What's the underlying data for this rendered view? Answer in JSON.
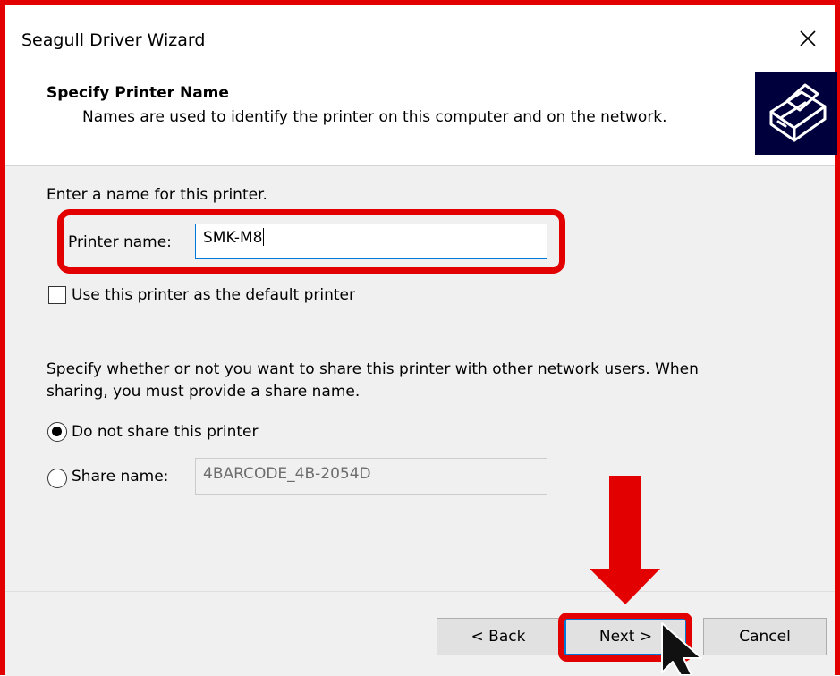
{
  "window": {
    "title": "Seagull Driver Wizard",
    "close_glyph": "✕"
  },
  "header": {
    "title": "Specify Printer Name",
    "subtitle": "Names are used to identify the printer on this computer and on the network.",
    "icon": "printer-icon"
  },
  "form": {
    "prompt": "Enter a name for this printer.",
    "printer_name_label": "Printer name:",
    "printer_name_value": "SMK-M8",
    "default_checkbox_label": "Use this printer as the default printer",
    "default_checkbox_checked": false,
    "share_text_line1": "Specify whether or not you want to share this printer with other network users.  When",
    "share_text_line2": "sharing, you must provide a share name.",
    "do_not_share_label": "Do not share this printer",
    "do_not_share_selected": true,
    "share_name_label": "Share name:",
    "share_name_selected": false,
    "share_name_value": "4BARCODE_4B-2054D"
  },
  "footer": {
    "back_label": "< Back",
    "next_label": "Next >",
    "cancel_label": "Cancel"
  },
  "annotations": {
    "highlight_color": "#e30000",
    "arrow_icon": "down-arrow-icon",
    "cursor_icon": "mouse-cursor-icon"
  }
}
